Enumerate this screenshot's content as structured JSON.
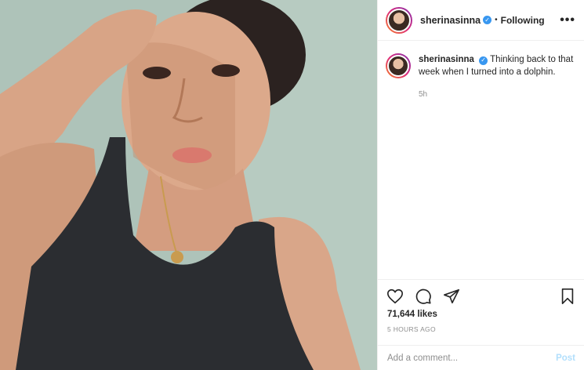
{
  "photo": {
    "alt_icon": "selfie-photo"
  },
  "header": {
    "username": "sherinasinna",
    "verified_icon": "verified-badge-icon",
    "dot": "•",
    "follow_status": "Following",
    "more_icon": "more-options-icon",
    "more_glyph": "•••"
  },
  "caption": {
    "username": "sherinasinna",
    "text": "Thinking back to that week when I turned into a dolphin.",
    "time": "5h"
  },
  "actions": {
    "like_icon": "heart-icon",
    "comment_icon": "comment-icon",
    "share_icon": "paper-plane-icon",
    "save_icon": "bookmark-icon"
  },
  "stats": {
    "likes": "71,644 likes",
    "posted": "5 HOURS AGO"
  },
  "comment": {
    "placeholder": "Add a comment...",
    "post_label": "Post"
  },
  "colors": {
    "accent": "#3897f0",
    "post_disabled": "#b2dffc",
    "muted": "#8e8e8e"
  }
}
